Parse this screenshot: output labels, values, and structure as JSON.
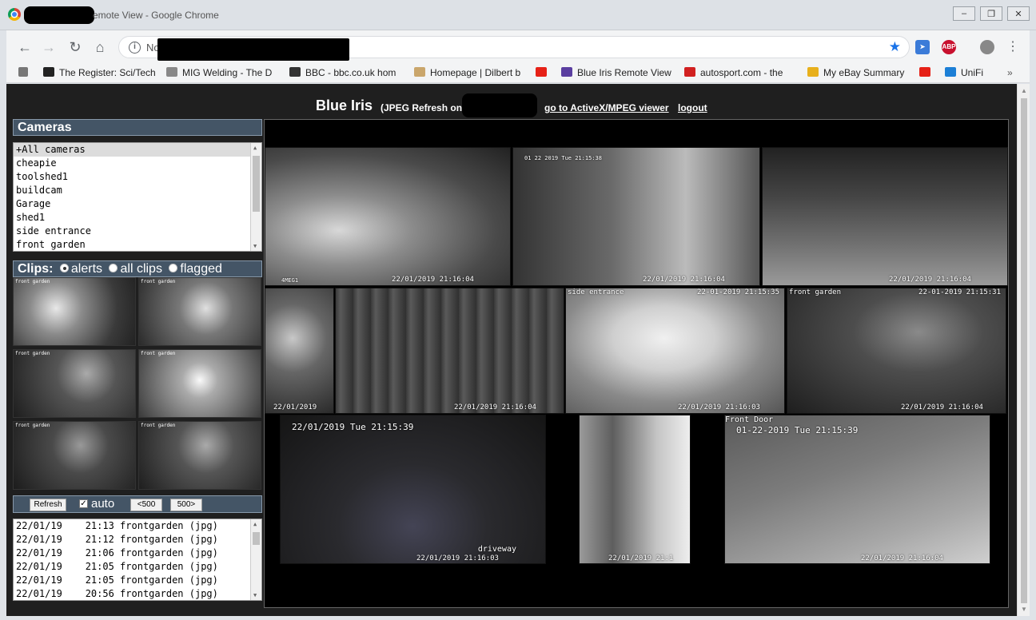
{
  "window": {
    "title": "Remote View - Google Chrome",
    "title_visible": "emote View - Google Chrome",
    "controls": [
      "minimize",
      "restore",
      "close"
    ]
  },
  "toolbar": {
    "url_prefix": "No",
    "icons": [
      "back-icon",
      "forward-icon",
      "reload-icon",
      "home-icon",
      "info-icon",
      "star-icon"
    ],
    "extensions": [
      "cursor-ext",
      "ABP",
      "avatar"
    ]
  },
  "bookmarks": [
    {
      "label": "The Register: Sci/Tech",
      "color": "#222"
    },
    {
      "label": "MIG Welding - The D",
      "color": "#777"
    },
    {
      "label": "BBC - bbc.co.uk hom",
      "color": "#333"
    },
    {
      "label": "Homepage | Dilbert b",
      "color": "#caa66b"
    },
    {
      "label": "",
      "color": "#e62117"
    },
    {
      "label": "Blue Iris Remote View",
      "color": "#5a3ea0"
    },
    {
      "label": "autosport.com - the",
      "color": "#d12020"
    },
    {
      "label": "My eBay Summary",
      "color": "#e8b01c"
    },
    {
      "label": "",
      "color": "#e62117"
    },
    {
      "label": "UniFi",
      "color": "#1c7fd6"
    }
  ],
  "header": {
    "brand": "Blue Iris",
    "sub": "(JPEG Refresh on",
    "activex_link": "go to ActiveX/MPEG viewer",
    "logout_link": "logout"
  },
  "cameras": {
    "heading": "Cameras",
    "items": [
      "+All cameras",
      "cheapie",
      "toolshed1",
      "buildcam",
      "Garage",
      "shed1",
      "side entrance",
      "front garden"
    ],
    "selected": 0
  },
  "clips": {
    "heading": "Clips:",
    "options": [
      "alerts",
      "all clips",
      "flagged"
    ],
    "selected": 0,
    "thumbs": [
      {
        "cap": "front garden"
      },
      {
        "cap": "front garden"
      },
      {
        "cap": "front garden"
      },
      {
        "cap": "front garden"
      },
      {
        "cap": "front garden"
      },
      {
        "cap": "front garden"
      }
    ],
    "refresh_label": "Refresh",
    "auto_label": "auto",
    "auto_checked": true,
    "prev_label": "<500",
    "next_label": "500>"
  },
  "log": [
    "22/01/19    21:13 frontgarden (jpg)",
    "22/01/19    21:12 frontgarden (jpg)",
    "22/01/19    21:06 frontgarden (jpg)",
    "22/01/19    21:05 frontgarden (jpg)",
    "22/01/19    21:05 frontgarden (jpg)",
    "22/01/19    20:56 frontgarden (jpg)"
  ],
  "feeds": {
    "cam1": {
      "bottom": "22/01/2019 21:16:04",
      "top": "",
      "corner": "4MEG1"
    },
    "cam2": {
      "top": "01 22 2019 Tue 21:15:38",
      "bottom": "22/01/2019 21:16:04"
    },
    "cam3": {
      "bottom": "22/01/2019 21:16:04"
    },
    "cam4": {
      "bottom": "22/01/2019"
    },
    "cam5": {
      "bottom": "22/01/2019 21:16:04"
    },
    "cam6": {
      "top_left": "side entrance",
      "top_right": "22-01-2019 21:15:35",
      "bottom": "22/01/2019 21:16:03"
    },
    "cam7": {
      "top_left": "front garden",
      "top_right": "22-01-2019 21:15:31",
      "bottom": "22/01/2019 21:16:04"
    },
    "cam8": {
      "top": "22/01/2019 Tue 21:15:39",
      "corner": "driveway",
      "bottom": "22/01/2019 21:16:03"
    },
    "cam9": {
      "bottom": "22/01/2019 21:1"
    },
    "cam10": {
      "top_left": "Front Door",
      "top": "01-22-2019 Tue 21:15:39",
      "bottom": "22/01/2019 21:16:04"
    }
  }
}
